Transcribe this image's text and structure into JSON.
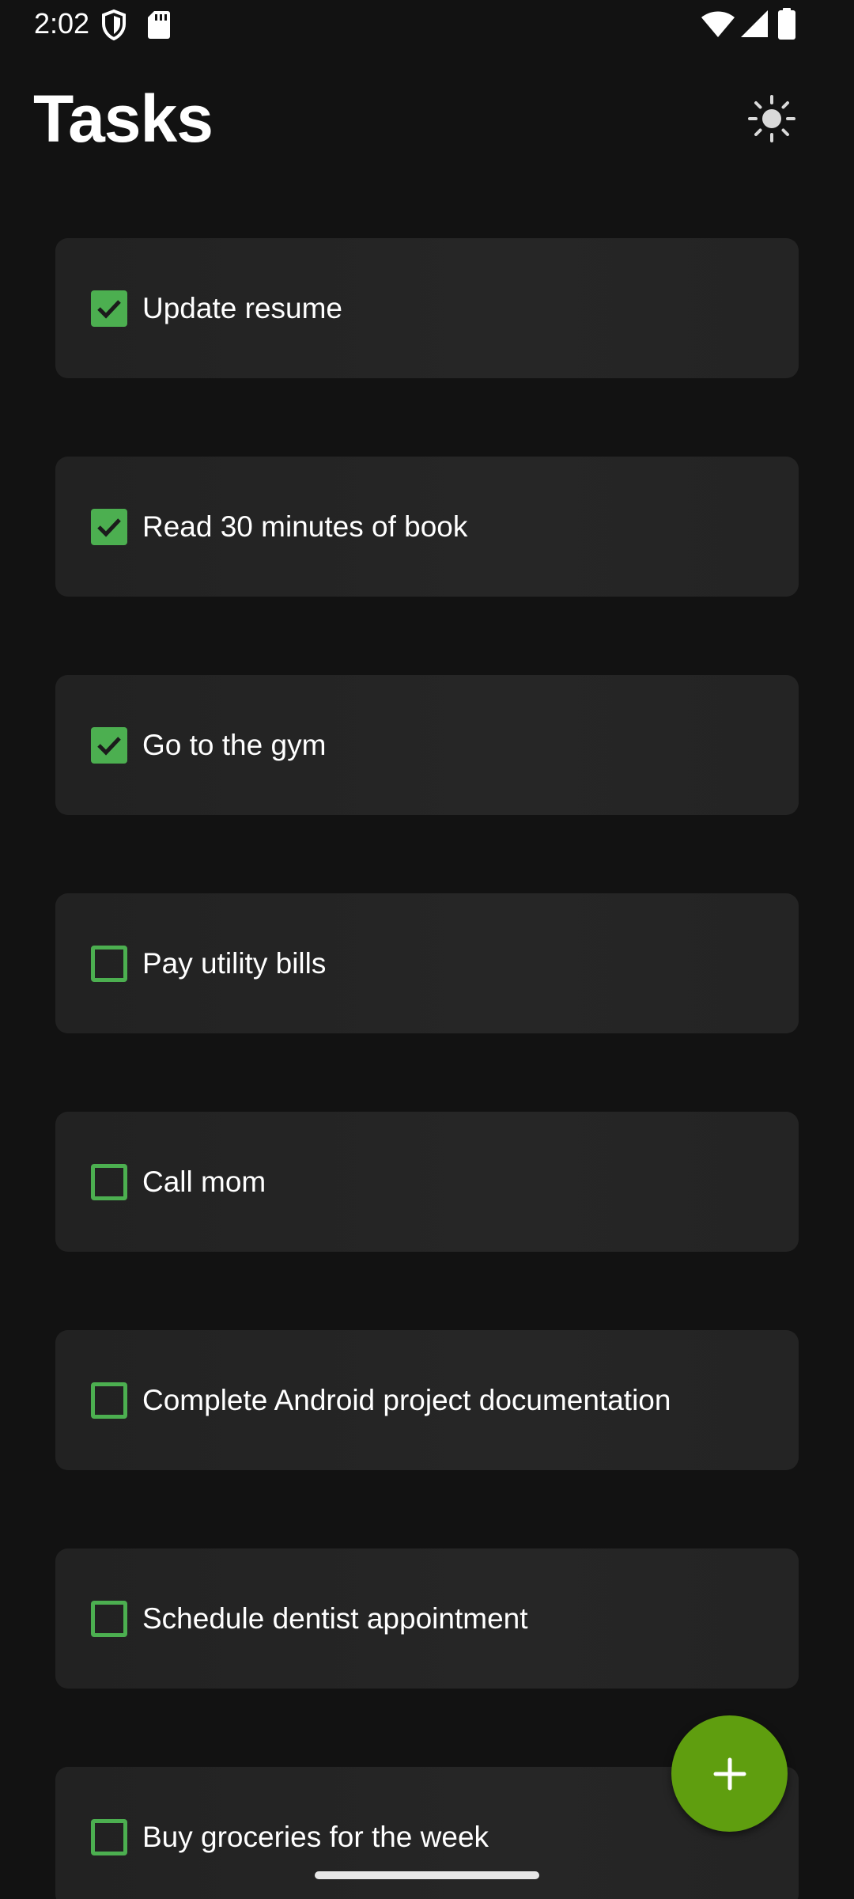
{
  "status_bar": {
    "time": "2:02",
    "icons": [
      "shield-icon",
      "sd-card-icon",
      "wifi-icon",
      "cellular-signal-icon",
      "battery-icon"
    ]
  },
  "header": {
    "title": "Tasks",
    "theme_toggle_icon": "sun-icon"
  },
  "colors": {
    "background": "#121212",
    "card": "#242424",
    "checkbox_accent": "#4caf50",
    "fab": "#5f9e0f",
    "text": "#ffffff"
  },
  "tasks": [
    {
      "label": "Update resume",
      "checked": true
    },
    {
      "label": "Read 30 minutes of book",
      "checked": true
    },
    {
      "label": "Go to the gym",
      "checked": true
    },
    {
      "label": "Pay utility bills",
      "checked": false
    },
    {
      "label": "Call mom",
      "checked": false
    },
    {
      "label": "Complete Android project documentation",
      "checked": false
    },
    {
      "label": "Schedule dentist appointment",
      "checked": false
    },
    {
      "label": "Buy groceries for the week",
      "checked": false
    }
  ],
  "fab": {
    "icon": "plus-icon"
  }
}
